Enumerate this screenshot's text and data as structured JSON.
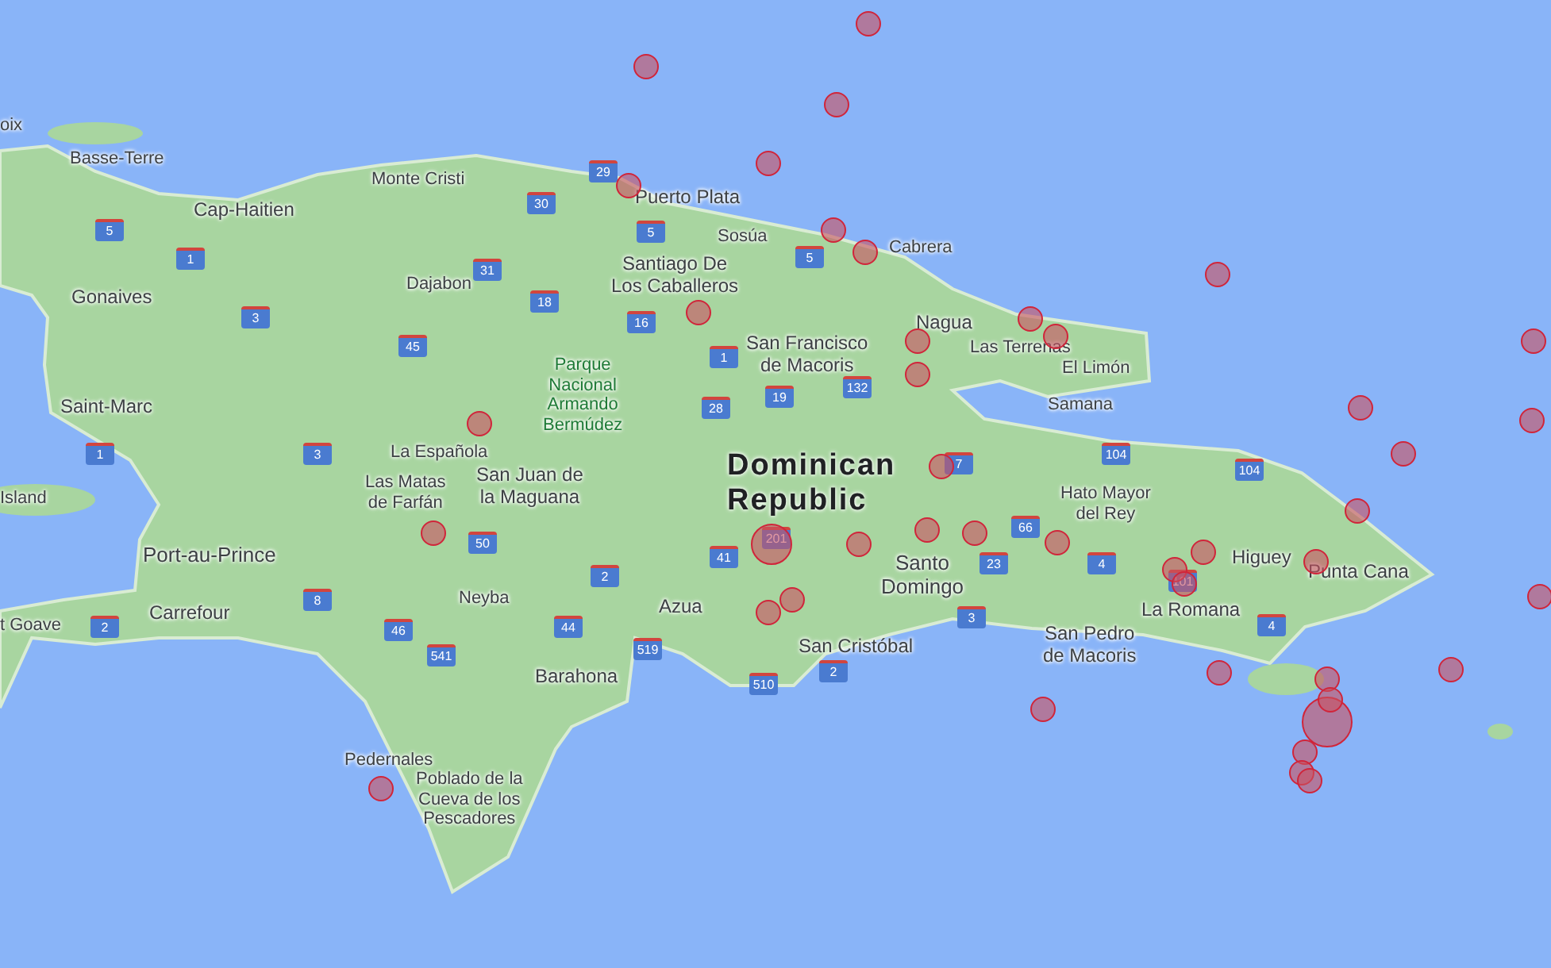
{
  "map": {
    "country_label": [
      "Dominican",
      "Republic"
    ],
    "place_labels": [
      {
        "lines": [
          "oix"
        ],
        "kind": "town"
      },
      {
        "lines": [
          "Basse-Terre"
        ],
        "kind": "town"
      },
      {
        "lines": [
          "Cap-Haitien"
        ],
        "kind": "city"
      },
      {
        "lines": [
          "Gonaives"
        ],
        "kind": "city"
      },
      {
        "lines": [
          "Saint-Marc"
        ],
        "kind": "city"
      },
      {
        "lines": [
          "Island"
        ],
        "kind": "town"
      },
      {
        "lines": [
          "Port-au-Prince"
        ],
        "kind": "capital"
      },
      {
        "lines": [
          "Carrefour"
        ],
        "kind": "city"
      },
      {
        "lines": [
          "t Goave"
        ],
        "kind": "town"
      },
      {
        "lines": [
          "Monte Cristi"
        ],
        "kind": "town"
      },
      {
        "lines": [
          "Puerto Plata"
        ],
        "kind": "city"
      },
      {
        "lines": [
          "Sosúa"
        ],
        "kind": "town"
      },
      {
        "lines": [
          "Cabrera"
        ],
        "kind": "town"
      },
      {
        "lines": [
          "Dajabon"
        ],
        "kind": "town"
      },
      {
        "lines": [
          "Santiago De",
          "Los Caballeros"
        ],
        "kind": "city"
      },
      {
        "lines": [
          "San Francisco",
          "de Macoris"
        ],
        "kind": "city"
      },
      {
        "lines": [
          "Nagua"
        ],
        "kind": "city"
      },
      {
        "lines": [
          "Las Terrenas"
        ],
        "kind": "town"
      },
      {
        "lines": [
          "El Limón"
        ],
        "kind": "town"
      },
      {
        "lines": [
          "Samana"
        ],
        "kind": "town"
      },
      {
        "lines": [
          "Parque",
          "Nacional",
          "Armando",
          "Bermúdez"
        ],
        "kind": "park"
      },
      {
        "lines": [
          "La Española"
        ],
        "kind": "town"
      },
      {
        "lines": [
          "Las Matas",
          "de Farfán"
        ],
        "kind": "town"
      },
      {
        "lines": [
          "San Juan de",
          "la Maguana"
        ],
        "kind": "city"
      },
      {
        "lines": [
          "Hato Mayor",
          "del Rey"
        ],
        "kind": "town"
      },
      {
        "lines": [
          "Higuey"
        ],
        "kind": "city"
      },
      {
        "lines": [
          "Punta Cana"
        ],
        "kind": "city"
      },
      {
        "lines": [
          "Santo",
          "Domingo"
        ],
        "kind": "capital"
      },
      {
        "lines": [
          "La Romana"
        ],
        "kind": "city"
      },
      {
        "lines": [
          "San Pedro",
          "de Macoris"
        ],
        "kind": "city"
      },
      {
        "lines": [
          "Neyba"
        ],
        "kind": "town"
      },
      {
        "lines": [
          "Azua"
        ],
        "kind": "city"
      },
      {
        "lines": [
          "San Cristóbal"
        ],
        "kind": "city"
      },
      {
        "lines": [
          "Barahona"
        ],
        "kind": "city"
      },
      {
        "lines": [
          "Pedernales"
        ],
        "kind": "town"
      },
      {
        "lines": [
          "Poblado de la",
          "Cueva de los",
          "Pescadores"
        ],
        "kind": "town"
      }
    ],
    "road_shields": [
      "29",
      "30",
      "5",
      "31",
      "18",
      "45",
      "16",
      "1",
      "5",
      "7",
      "132",
      "19",
      "28",
      "104",
      "104",
      "66",
      "4",
      "3",
      "4",
      "101",
      "23",
      "50",
      "41",
      "201",
      "2",
      "44",
      "519",
      "3",
      "2",
      "510",
      "46",
      "541",
      "5",
      "1",
      "1",
      "3",
      "2",
      "8"
    ]
  },
  "markers": [
    {
      "kind": "small"
    },
    {
      "kind": "small"
    },
    {
      "kind": "small"
    },
    {
      "kind": "small"
    },
    {
      "kind": "small"
    },
    {
      "kind": "small"
    },
    {
      "kind": "small"
    },
    {
      "kind": "small"
    },
    {
      "kind": "small"
    },
    {
      "kind": "small"
    },
    {
      "kind": "small"
    },
    {
      "kind": "small"
    },
    {
      "kind": "small"
    },
    {
      "kind": "small"
    },
    {
      "kind": "small"
    },
    {
      "kind": "small"
    },
    {
      "kind": "small"
    },
    {
      "kind": "small"
    },
    {
      "kind": "small"
    },
    {
      "kind": "small"
    },
    {
      "kind": "small"
    },
    {
      "kind": "small"
    },
    {
      "kind": "medium"
    },
    {
      "kind": "small"
    },
    {
      "kind": "small"
    },
    {
      "kind": "small"
    },
    {
      "kind": "small"
    },
    {
      "kind": "small"
    },
    {
      "kind": "small"
    },
    {
      "kind": "small"
    },
    {
      "kind": "small"
    },
    {
      "kind": "small"
    },
    {
      "kind": "small"
    },
    {
      "kind": "small"
    },
    {
      "kind": "small"
    },
    {
      "kind": "small"
    },
    {
      "kind": "small"
    },
    {
      "kind": "large"
    },
    {
      "kind": "small"
    },
    {
      "kind": "small"
    },
    {
      "kind": "small"
    },
    {
      "kind": "small"
    },
    {
      "kind": "small"
    }
  ]
}
